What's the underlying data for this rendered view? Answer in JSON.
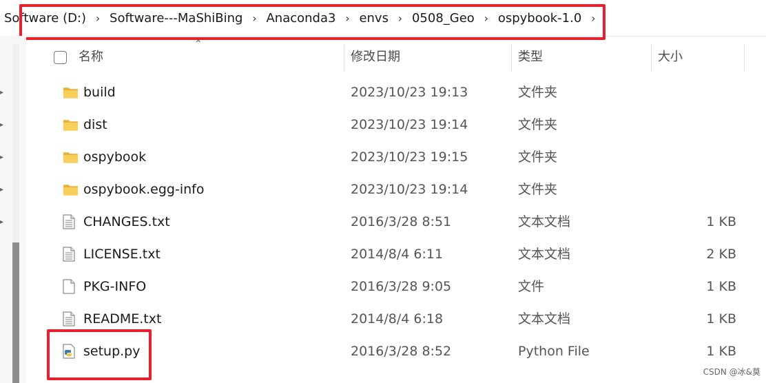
{
  "breadcrumbs": [
    "Software (D:)",
    "Software---MaShiBing",
    "Anaconda3",
    "envs",
    "0508_Geo",
    "ospybook-1.0"
  ],
  "columns": {
    "name": "名称",
    "date": "修改日期",
    "type": "类型",
    "size": "大小"
  },
  "files": [
    {
      "name": "build",
      "date": "2023/10/23 19:13",
      "type": "文件夹",
      "size": "",
      "icon": "folder-icon"
    },
    {
      "name": "dist",
      "date": "2023/10/23 19:14",
      "type": "文件夹",
      "size": "",
      "icon": "folder-icon"
    },
    {
      "name": "ospybook",
      "date": "2023/10/23 19:15",
      "type": "文件夹",
      "size": "",
      "icon": "folder-icon"
    },
    {
      "name": "ospybook.egg-info",
      "date": "2023/10/23 19:14",
      "type": "文件夹",
      "size": "",
      "icon": "folder-icon"
    },
    {
      "name": "CHANGES.txt",
      "date": "2016/3/28 8:51",
      "type": "文本文档",
      "size": "1 KB",
      "icon": "text-file-icon"
    },
    {
      "name": "LICENSE.txt",
      "date": "2014/8/4 6:11",
      "type": "文本文档",
      "size": "2 KB",
      "icon": "text-file-icon"
    },
    {
      "name": "PKG-INFO",
      "date": "2016/3/28 9:05",
      "type": "文件",
      "size": "1 KB",
      "icon": "blank-file-icon"
    },
    {
      "name": "README.txt",
      "date": "2014/8/4 6:18",
      "type": "文本文档",
      "size": "1 KB",
      "icon": "text-file-icon"
    },
    {
      "name": "setup.py",
      "date": "2016/3/28 8:52",
      "type": "Python File",
      "size": "1 KB",
      "icon": "python-file-icon"
    }
  ],
  "watermark": "CSDN @冰&莫",
  "colors": {
    "highlight": "#e8202e",
    "folder": "#f5c542"
  }
}
